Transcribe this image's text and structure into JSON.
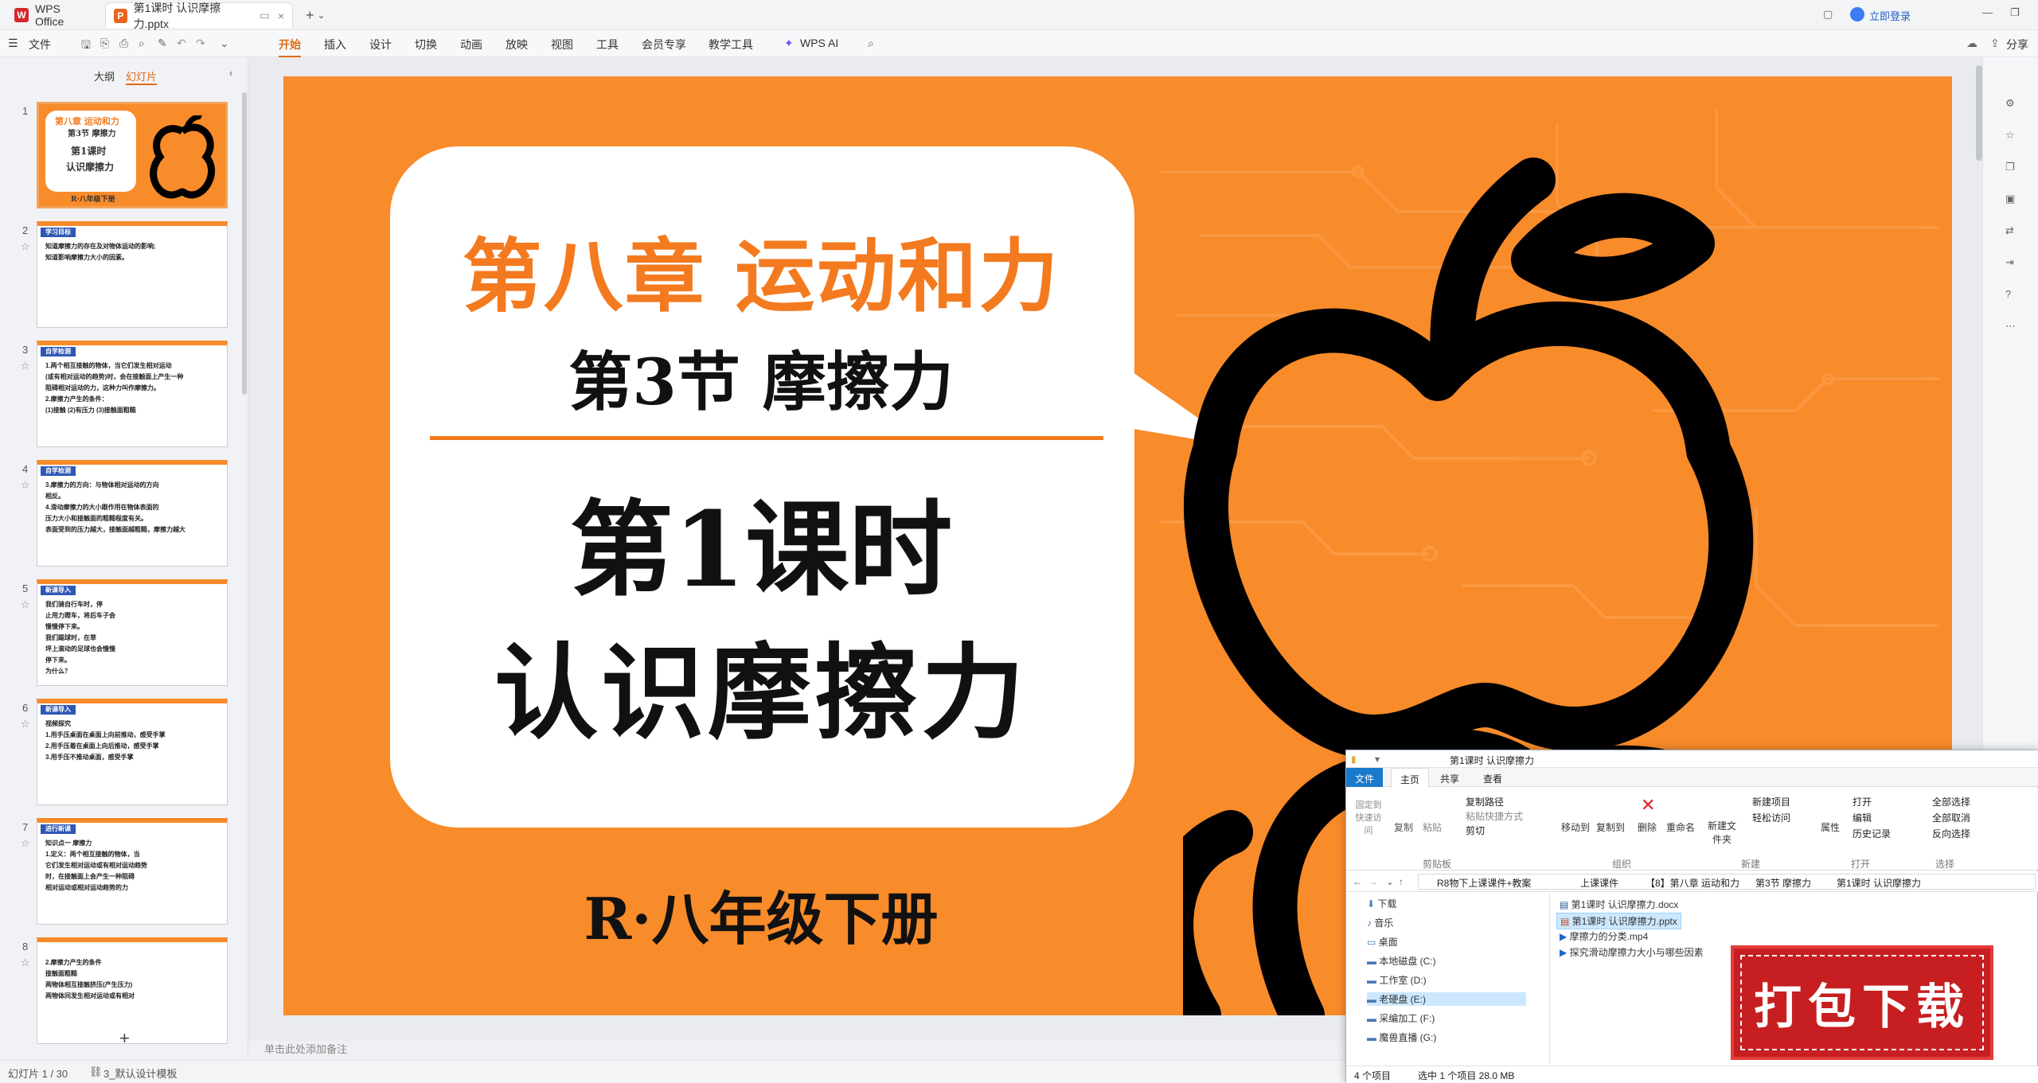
{
  "app": {
    "name": "WPS Office",
    "login": "立即登录"
  },
  "tabs": [
    {
      "label": "WPS Office"
    },
    {
      "label": "第1课时 认识摩擦力.pptx"
    }
  ],
  "ribbon": {
    "file_menu": "文件",
    "items": [
      "开始",
      "插入",
      "设计",
      "切换",
      "动画",
      "放映",
      "视图",
      "工具",
      "会员专享",
      "教学工具"
    ],
    "ai": "WPS AI",
    "share": "分享"
  },
  "panel": {
    "outline_tab": "大纲",
    "slides_tab": "幻灯片",
    "add": "+"
  },
  "thumbs": [
    {
      "num": "1",
      "l1": "第八章  运动和力",
      "l2": "第3节 摩擦力",
      "l3": "第1课时",
      "l4": "认识摩擦力",
      "l5": "R·八年级下册"
    },
    {
      "num": "2",
      "head": "学习目标",
      "lines": [
        "知道摩擦力的存在及对物体运动的影响;",
        "知道影响摩擦力大小的因素。"
      ]
    },
    {
      "num": "3",
      "head": "自学检测",
      "lines": [
        "1.两个相互接触的物体，当它们发生相对运动",
        "(或有相对运动的趋势)时，会在接触面上产生一种",
        "阻碍相对运动的力，这种力叫作摩擦力。",
        "2.摩擦力产生的条件：",
        "(1)接触 (2)有压力 (3)接触面粗糙"
      ]
    },
    {
      "num": "4",
      "head": "自学检测",
      "lines": [
        "3.摩擦力的方向：与物体相对运动的方向",
        "相反。",
        "4.滑动摩擦力的大小跟作用在物体表面的",
        "压力大小和接触面的粗糙程度有关。",
        "表面受到的压力越大，接触面越粗糙，摩擦力越大"
      ]
    },
    {
      "num": "5",
      "head": "新课导入",
      "lines": [
        "我们骑自行车时，停",
        "止用力蹬车，将后车子会",
        "慢慢停下来。",
        "我们踢球时，在草",
        "坪上滚动的足球也会慢慢",
        "停下来。",
        "为什么？"
      ]
    },
    {
      "num": "6",
      "head": "新课导入",
      "lines": [
        "视频探究",
        "1.用手压桌面在桌面上向前推动，感受手掌",
        "2.用手压着在桌面上向后推动，感受手掌",
        "3.用手压不推动桌面，感受手掌"
      ]
    },
    {
      "num": "7",
      "head": "进行新课",
      "lines": [
        "知识点一  摩擦力",
        "1.定义：两个相互接触的物体，当",
        "它们发生相对运动或有相对运动趋势",
        "时，在接触面上会产生一种阻碍",
        "相对运动或相对运动趋势的力"
      ]
    },
    {
      "num": "8",
      "head": "",
      "lines": [
        "2.摩擦力产生的条件",
        "接触面粗糙",
        "两物体相互接触挤压(产生压力)",
        "两物体间发生相对运动或有相对"
      ]
    }
  ],
  "slide": {
    "chapter": "第八章  运动和力",
    "section": "第3节 摩擦力",
    "lesson": "第1课时",
    "topic": "认识摩擦力",
    "grade": "R·八年级下册",
    "bg_color": "#f88b2a",
    "title_color": "#f47a1f"
  },
  "notes_placeholder": "单击此处添加备注",
  "status": {
    "page": "幻灯片 1 / 30",
    "theme": "3_默认设计模板"
  },
  "explorer": {
    "title": "第1课时 认识摩擦力",
    "menu": [
      "文件",
      "主页",
      "共享",
      "查看"
    ],
    "groups": [
      "剪贴板",
      "组织",
      "新建",
      "打开",
      "选择"
    ],
    "buttons": [
      "固定到快速访问",
      "复制",
      "粘贴",
      "复制路径",
      "粘贴快捷方式",
      "剪切",
      "移动到",
      "复制到",
      "删除",
      "重命名",
      "新建文件夹",
      "新建项目",
      "轻松访问",
      "属性",
      "打开",
      "编辑",
      "历史记录",
      "全部选择",
      "全部取消",
      "反向选择"
    ],
    "path": [
      "R8物下上课课件+教案",
      "上课课件",
      "【8】第八章 运动和力",
      "第3节 摩擦力",
      "第1课时 认识摩擦力"
    ],
    "nav": [
      "下载",
      "音乐",
      "桌面",
      "本地磁盘 (C:)",
      "工作室 (D:)",
      "老硬盘 (E:)",
      "采编加工 (F:)",
      "魔兽直播 (G:)"
    ],
    "files": [
      "第1课时 认识摩擦力.docx",
      "第1课时 认识摩擦力.pptx",
      "摩擦力的分类.mp4",
      "探究滑动摩擦力大小与哪些因素"
    ],
    "status": [
      "4 个项目",
      "选中 1 个项目  28.0 MB"
    ]
  },
  "download_badge": "打包下载"
}
